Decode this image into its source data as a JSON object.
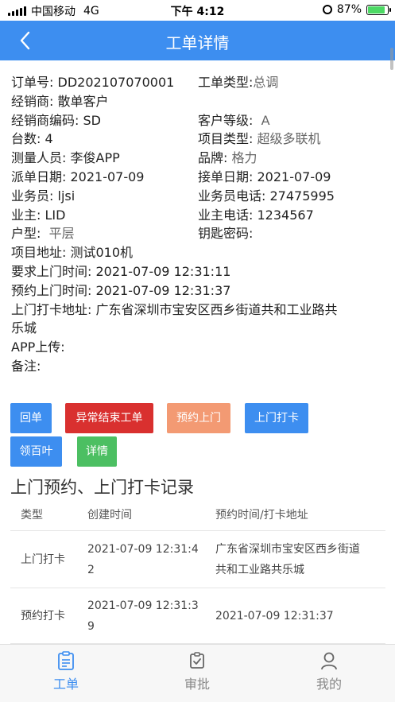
{
  "status_bar": {
    "carrier": "中国移动",
    "network": "4G",
    "time": "下午 4:12",
    "battery": "87%",
    "battery_level": 0.87
  },
  "header": {
    "title": "工单详情"
  },
  "details": {
    "order_no_label": "订单号:",
    "order_no": "DD202107070001",
    "order_type_label": "工单类型:",
    "order_type": "总调",
    "dealer_label": "经销商:",
    "dealer": "散单客户",
    "dealer_code_label": "经销商编码:",
    "dealer_code": "SD",
    "customer_level_label": "客户等级:",
    "customer_level": "A",
    "units_label": "台数:",
    "units": "4",
    "project_type_label": "项目类型:",
    "project_type": "超级多联机",
    "surveyor_label": "测量人员:",
    "surveyor": "李俊APP",
    "brand_label": "品牌:",
    "brand": "格力",
    "dispatch_date_label": "派单日期:",
    "dispatch_date": "2021-07-09",
    "accept_date_label": "接单日期:",
    "accept_date": "2021-07-09",
    "salesman_label": "业务员:",
    "salesman": "ljsi",
    "salesman_phone_label": "业务员电话:",
    "salesman_phone": "27475995",
    "owner_label": "业主:",
    "owner": "LID",
    "owner_phone_label": "业主电话:",
    "owner_phone": "1234567",
    "house_type_label": "户型:",
    "house_type": "平层",
    "key_password_label": "钥匙密码:",
    "key_password": "",
    "project_address_label": "项目地址:",
    "project_address": "测试010机",
    "required_visit_label": "要求上门时间:",
    "required_visit": "2021-07-09 12:31:11",
    "booked_visit_label": "预约上门时间:",
    "booked_visit": "2021-07-09 12:31:37",
    "checkin_address_label": "上门打卡地址:",
    "checkin_address_line1": "广东省深圳市宝安区西乡街道共和工业路共",
    "checkin_address_line2": "乐城",
    "app_upload_label": "APP上传:",
    "app_upload": "",
    "remark_label": "备注:",
    "remark": ""
  },
  "actions": {
    "reply": "回单",
    "abnormal_end": "异常结束工单",
    "book_visit": "预约上门",
    "checkin": "上门打卡",
    "louver": "领百叶",
    "detail": "详情"
  },
  "colors": {
    "primary": "#3d8ef0",
    "danger": "#d9302f",
    "warning": "#f39a73",
    "success": "#4cbf62"
  },
  "records": {
    "title": "上门预约、上门打卡记录",
    "columns": [
      "类型",
      "创建时间",
      "预约时间/打卡地址"
    ],
    "rows": [
      {
        "type": "上门打卡",
        "created_line1": "2021-07-09 12:31:4",
        "created_line2": "2",
        "info_line1": "广东省深圳市宝安区西乡街道",
        "info_line2": "共和工业路共乐城"
      },
      {
        "type": "预约打卡",
        "created_line1": "2021-07-09 12:31:3",
        "created_line2": "9",
        "info_line1": "2021-07-09 12:31:37",
        "info_line2": ""
      }
    ]
  },
  "tabbar": [
    {
      "label": "工单",
      "icon": "clipboard-icon",
      "active": true
    },
    {
      "label": "审批",
      "icon": "approval-icon",
      "active": false
    },
    {
      "label": "我的",
      "icon": "user-icon",
      "active": false
    }
  ]
}
